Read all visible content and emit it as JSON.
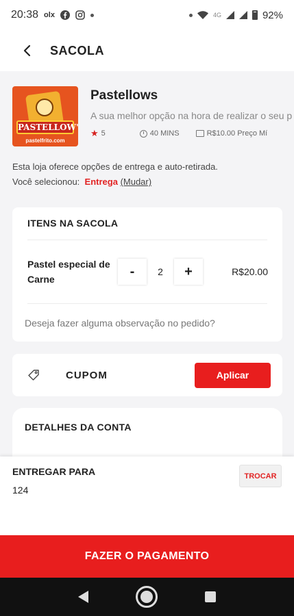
{
  "status_bar": {
    "time": "20:38",
    "olx": "olx",
    "network_label": "4G",
    "battery": "92%"
  },
  "header": {
    "title": "SACOLA"
  },
  "store": {
    "name": "Pastellows",
    "description": "A sua melhor opção na hora de realizar o seu p",
    "rating": "5",
    "time": "40 MINS",
    "price": "R$10.00 Preço Mí",
    "logo_text": "PASTELLOW'S",
    "logo_url": "pastelfrito.com"
  },
  "delivery": {
    "info": "Esta loja oferece opções de entrega e auto-retirada.",
    "selected_prefix": "Você selecionou:",
    "selected_value": "Entrega",
    "change_label": "(Mudar)"
  },
  "cart": {
    "title": "ITENS NA SACOLA",
    "items": [
      {
        "name": "Pastel especial de Carne",
        "quantity": "2",
        "price": "R$20.00",
        "minus": "-",
        "plus": "+"
      }
    ],
    "observation_placeholder": "Deseja fazer alguma observação no pedido?"
  },
  "coupon": {
    "label": "CUPOM",
    "apply_label": "Aplicar"
  },
  "details": {
    "title": "DETALHES DA CONTA"
  },
  "deliver_to": {
    "label": "ENTREGAR PARA",
    "value": "124",
    "change_label": "TROCAR"
  },
  "payment": {
    "label": "FAZER O PAGAMENTO"
  },
  "colors": {
    "accent": "#e81e1e",
    "background": "#f4f4f6"
  }
}
